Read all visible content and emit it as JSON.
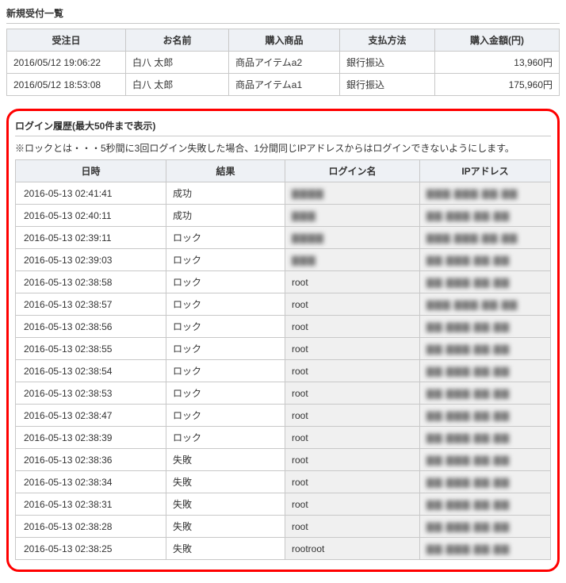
{
  "orders": {
    "title": "新規受付一覧",
    "headers": {
      "date": "受注日",
      "name": "お名前",
      "product": "購入商品",
      "payment": "支払方法",
      "amount": "購入金額(円)"
    },
    "rows": [
      {
        "date": "2016/05/12 19:06:22",
        "name": "白八 太郎",
        "product": "商品アイテムa2",
        "payment": "銀行振込",
        "amount": "13,960円"
      },
      {
        "date": "2016/05/12 18:53:08",
        "name": "白八 太郎",
        "product": "商品アイテムa1",
        "payment": "銀行振込",
        "amount": "175,960円"
      }
    ]
  },
  "login": {
    "title": "ログイン履歴(最大50件まで表示)",
    "note": "※ロックとは・・・5秒間に3回ログイン失敗した場合、1分間同じIPアドレスからはログインできないようにします。",
    "headers": {
      "datetime": "日時",
      "result": "結果",
      "login": "ログイン名",
      "ip": "IPアドレス"
    },
    "rows": [
      {
        "datetime": "2016-05-13 02:41:41",
        "result": "成功",
        "login": "▇▇▇▇",
        "ip": "▇▇▇.▇▇▇.▇▇.▇▇"
      },
      {
        "datetime": "2016-05-13 02:40:11",
        "result": "成功",
        "login": "▇▇▇",
        "ip": "▇▇.▇▇▇.▇▇.▇▇"
      },
      {
        "datetime": "2016-05-13 02:39:11",
        "result": "ロック",
        "login": "▇▇▇▇",
        "ip": "▇▇▇.▇▇▇.▇▇.▇▇"
      },
      {
        "datetime": "2016-05-13 02:39:03",
        "result": "ロック",
        "login": "▇▇▇",
        "ip": "▇▇.▇▇▇.▇▇.▇▇"
      },
      {
        "datetime": "2016-05-13 02:38:58",
        "result": "ロック",
        "login": "root",
        "ip": "▇▇.▇▇▇.▇▇.▇▇"
      },
      {
        "datetime": "2016-05-13 02:38:57",
        "result": "ロック",
        "login": "root",
        "ip": "▇▇▇.▇▇▇.▇▇.▇▇"
      },
      {
        "datetime": "2016-05-13 02:38:56",
        "result": "ロック",
        "login": "root",
        "ip": "▇▇.▇▇▇.▇▇.▇▇"
      },
      {
        "datetime": "2016-05-13 02:38:55",
        "result": "ロック",
        "login": "root",
        "ip": "▇▇.▇▇▇.▇▇.▇▇"
      },
      {
        "datetime": "2016-05-13 02:38:54",
        "result": "ロック",
        "login": "root",
        "ip": "▇▇.▇▇▇.▇▇.▇▇"
      },
      {
        "datetime": "2016-05-13 02:38:53",
        "result": "ロック",
        "login": "root",
        "ip": "▇▇.▇▇▇.▇▇.▇▇"
      },
      {
        "datetime": "2016-05-13 02:38:47",
        "result": "ロック",
        "login": "root",
        "ip": "▇▇.▇▇▇.▇▇.▇▇"
      },
      {
        "datetime": "2016-05-13 02:38:39",
        "result": "ロック",
        "login": "root",
        "ip": "▇▇.▇▇▇.▇▇.▇▇"
      },
      {
        "datetime": "2016-05-13 02:38:36",
        "result": "失敗",
        "login": "root",
        "ip": "▇▇.▇▇▇.▇▇.▇▇"
      },
      {
        "datetime": "2016-05-13 02:38:34",
        "result": "失敗",
        "login": "root",
        "ip": "▇▇.▇▇▇.▇▇.▇▇"
      },
      {
        "datetime": "2016-05-13 02:38:31",
        "result": "失敗",
        "login": "root",
        "ip": "▇▇.▇▇▇.▇▇.▇▇"
      },
      {
        "datetime": "2016-05-13 02:38:28",
        "result": "失敗",
        "login": "root",
        "ip": "▇▇.▇▇▇.▇▇.▇▇"
      },
      {
        "datetime": "2016-05-13 02:38:25",
        "result": "失敗",
        "login": "rootroot",
        "ip": "▇▇.▇▇▇.▇▇.▇▇"
      }
    ]
  }
}
